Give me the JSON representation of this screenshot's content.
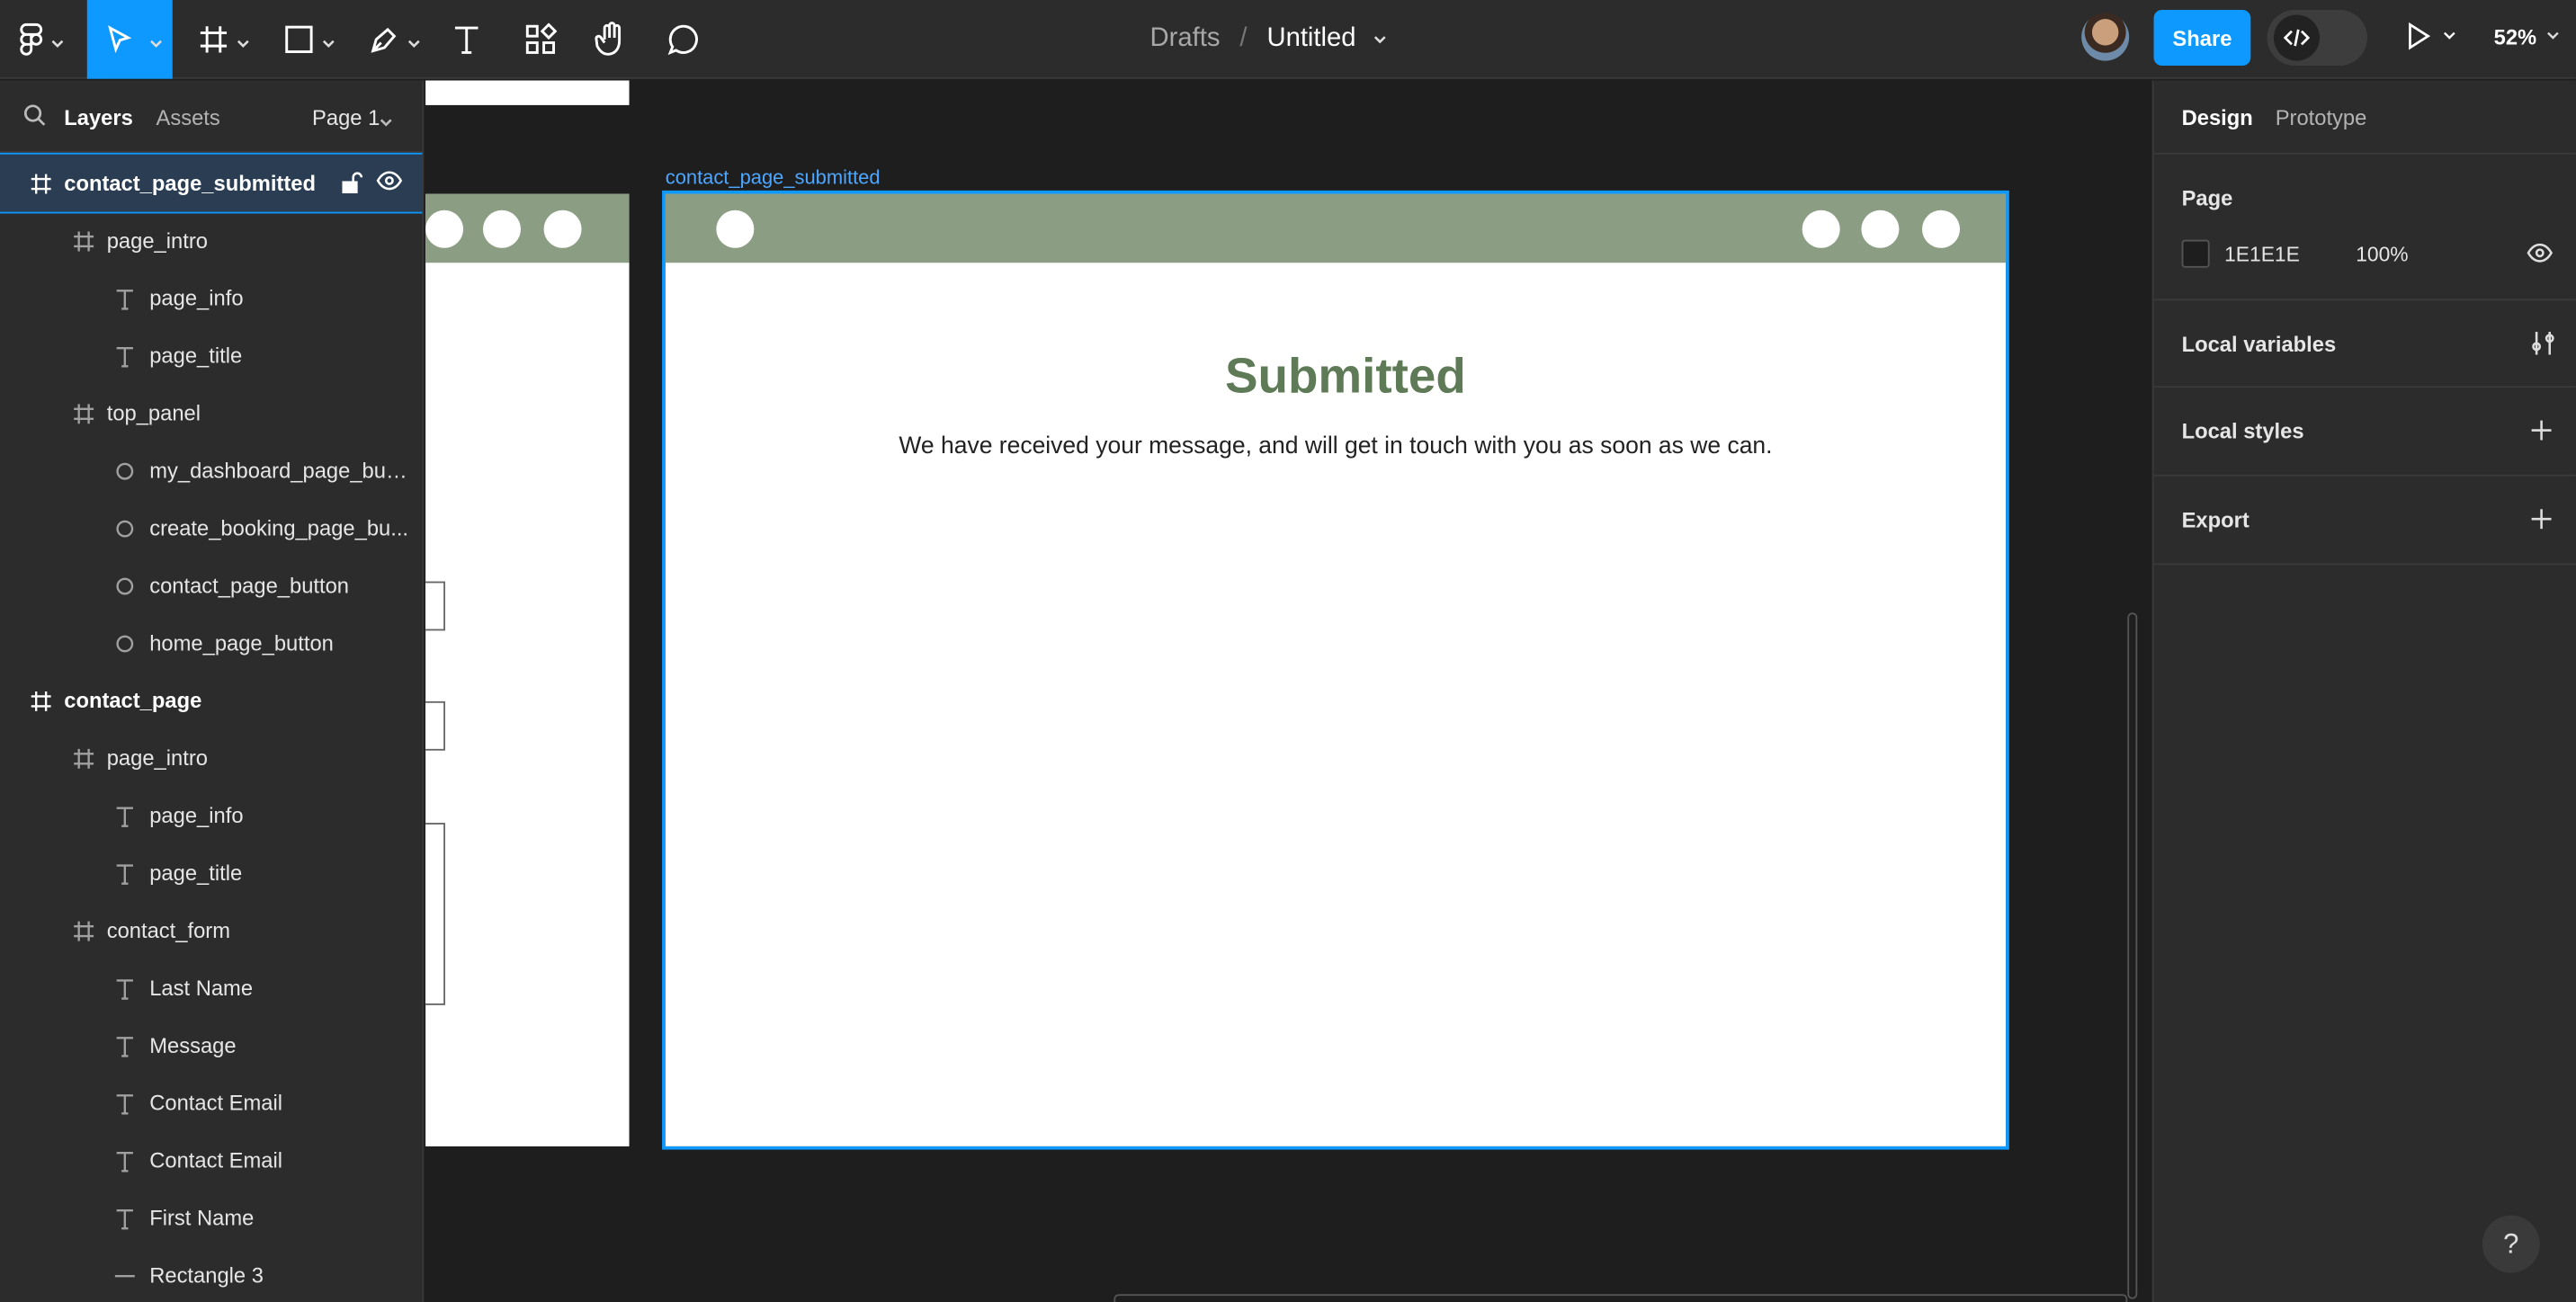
{
  "toolbar": {
    "breadcrumb_drafts": "Drafts",
    "breadcrumb_sep": "/",
    "file_title": "Untitled",
    "share_label": "Share",
    "zoom": "52%"
  },
  "left_panel": {
    "tab_layers": "Layers",
    "tab_assets": "Assets",
    "page_selector": "Page 1",
    "layers": [
      {
        "label": "contact_page_submitted",
        "type": "frame",
        "level": 0,
        "selected": true
      },
      {
        "label": "page_intro",
        "type": "frame",
        "level": 1
      },
      {
        "label": "page_info",
        "type": "text",
        "level": 2
      },
      {
        "label": "page_title",
        "type": "text",
        "level": 2
      },
      {
        "label": "top_panel",
        "type": "frame",
        "level": 1
      },
      {
        "label": "my_dashboard_page_butt...",
        "type": "ellipse",
        "level": 2
      },
      {
        "label": "create_booking_page_bu...",
        "type": "ellipse",
        "level": 2
      },
      {
        "label": "contact_page_button",
        "type": "ellipse",
        "level": 2
      },
      {
        "label": "home_page_button",
        "type": "ellipse",
        "level": 2
      },
      {
        "label": "contact_page",
        "type": "frame",
        "level": 0
      },
      {
        "label": "page_intro",
        "type": "frame",
        "level": 1
      },
      {
        "label": "page_info",
        "type": "text",
        "level": 2
      },
      {
        "label": "page_title",
        "type": "text",
        "level": 2
      },
      {
        "label": "contact_form",
        "type": "frame",
        "level": 1
      },
      {
        "label": "Last Name",
        "type": "text",
        "level": 2
      },
      {
        "label": "Message",
        "type": "text",
        "level": 2
      },
      {
        "label": "Contact Email",
        "type": "text",
        "level": 2
      },
      {
        "label": "Contact Email",
        "type": "text",
        "level": 2
      },
      {
        "label": "First Name",
        "type": "text",
        "level": 2
      },
      {
        "label": "Rectangle 3",
        "type": "line",
        "level": 2
      }
    ]
  },
  "canvas": {
    "frame_label": "contact_page_submitted",
    "heading": "Submitted",
    "message": "We have received your message, and will get in touch with you as soon as we can.",
    "header_color": "#8b9d83",
    "heading_color": "#5e7a56"
  },
  "right_panel": {
    "tab_design": "Design",
    "tab_prototype": "Prototype",
    "page_section_title": "Page",
    "page_bg_hex": "1E1E1E",
    "page_bg_opacity": "100%",
    "local_variables": "Local variables",
    "local_styles": "Local styles",
    "export": "Export"
  },
  "help_label": "?"
}
